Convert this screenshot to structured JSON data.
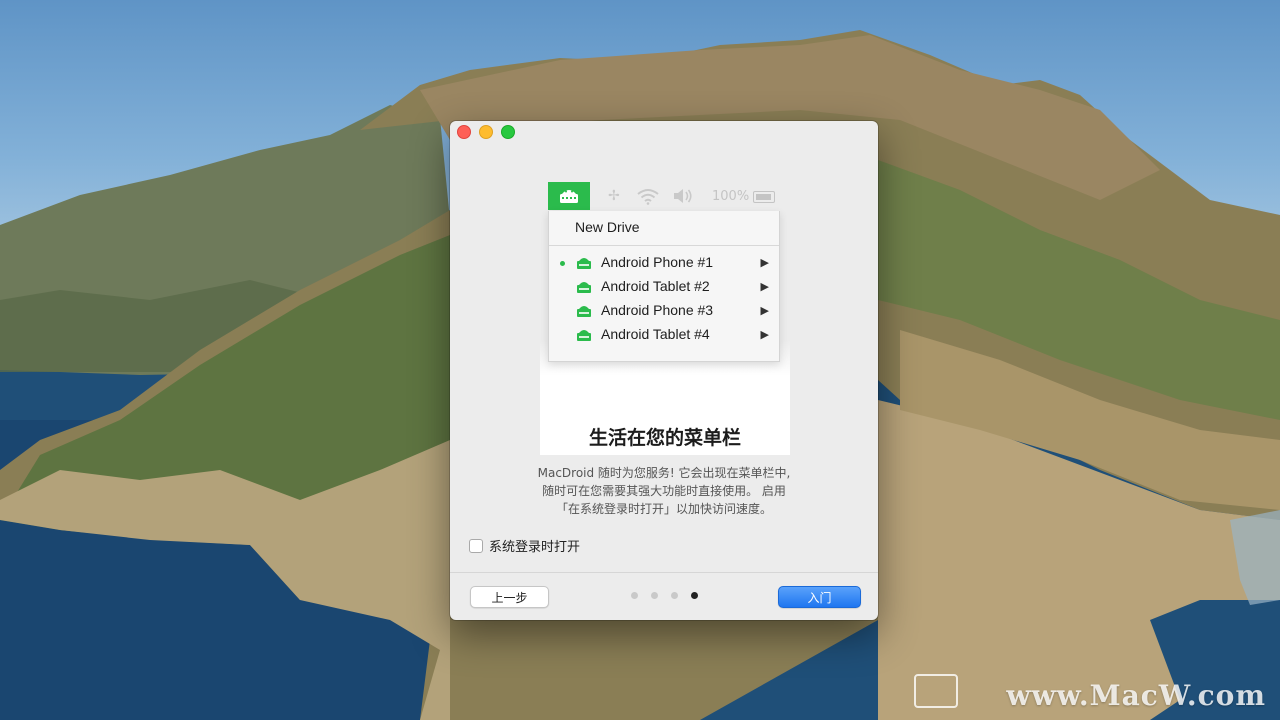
{
  "window": {
    "traffic_lights": [
      "close",
      "minimize",
      "zoom"
    ]
  },
  "illustration": {
    "menubar": {
      "battery_text": "100%",
      "icons": [
        "android-drive-icon",
        "bluetooth-icon",
        "wifi-icon",
        "volume-icon",
        "battery-icon"
      ]
    },
    "menu": {
      "new_drive": "New Drive",
      "items": [
        {
          "label": "Android Phone #1",
          "active": true
        },
        {
          "label": "Android Tablet #2",
          "active": false
        },
        {
          "label": "Android Phone #3",
          "active": false
        },
        {
          "label": "Android Tablet #4",
          "active": false
        }
      ]
    }
  },
  "headline": "生活在您的菜单栏",
  "description": {
    "line1": "MacDroid 随时为您服务! 它会出现在菜单栏中,",
    "line2": "随时可在您需要其强大功能时直接使用。 启用",
    "line3": "「在系统登录时打开」以加快访问速度。"
  },
  "checkbox": {
    "label": "系统登录时打开",
    "checked": false
  },
  "footer": {
    "back_label": "上一步",
    "start_label": "入门",
    "pages": 4,
    "current_page": 4
  },
  "watermark": "www.MacW.com",
  "colors": {
    "accent_green": "#2bbb4c",
    "primary_blue": "#1f76f0"
  }
}
